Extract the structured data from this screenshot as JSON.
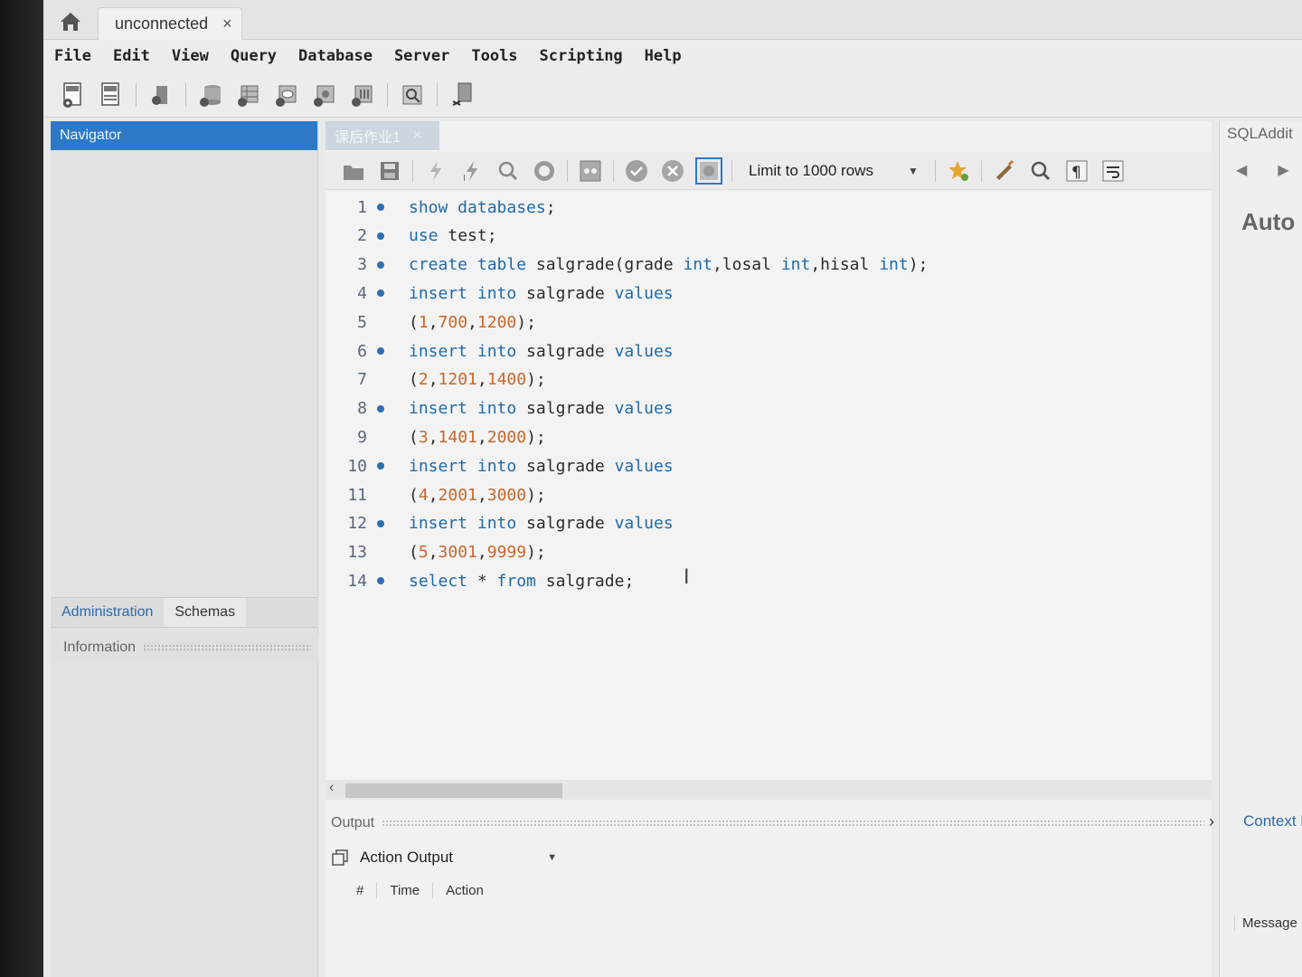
{
  "tabs": {
    "connection_label": "unconnected",
    "close_glyph": "×",
    "home_icon": "home-icon"
  },
  "menu": [
    "File",
    "Edit",
    "View",
    "Query",
    "Database",
    "Server",
    "Tools",
    "Scripting",
    "Help"
  ],
  "navigator": {
    "title": "Navigator",
    "tabs": [
      "Administration",
      "Schemas"
    ],
    "info_label": "Information"
  },
  "editor": {
    "tab_label": "课后作业1",
    "limit_label": "Limit to 1000 rows",
    "lines": [
      {
        "n": "1",
        "bp": true,
        "tokens": [
          {
            "t": "show databases",
            "c": "kw"
          },
          {
            "t": ";"
          }
        ]
      },
      {
        "n": "2",
        "bp": true,
        "tokens": [
          {
            "t": "use",
            "c": "kw"
          },
          {
            "t": " test;"
          }
        ]
      },
      {
        "n": "3",
        "bp": true,
        "tokens": [
          {
            "t": "create table",
            "c": "kw"
          },
          {
            "t": " salgrade(grade "
          },
          {
            "t": "int",
            "c": "kw"
          },
          {
            "t": ",losal "
          },
          {
            "t": "int",
            "c": "kw"
          },
          {
            "t": ",hisal "
          },
          {
            "t": "int",
            "c": "kw"
          },
          {
            "t": ");"
          }
        ]
      },
      {
        "n": "4",
        "bp": true,
        "tokens": [
          {
            "t": "insert into",
            "c": "kw"
          },
          {
            "t": " salgrade "
          },
          {
            "t": "values",
            "c": "kw"
          }
        ]
      },
      {
        "n": "5",
        "bp": false,
        "tokens": [
          {
            "t": "("
          },
          {
            "t": "1",
            "c": "num"
          },
          {
            "t": ","
          },
          {
            "t": "700",
            "c": "num"
          },
          {
            "t": ","
          },
          {
            "t": "1200",
            "c": "num"
          },
          {
            "t": ");"
          }
        ]
      },
      {
        "n": "6",
        "bp": true,
        "tokens": [
          {
            "t": "insert into",
            "c": "kw"
          },
          {
            "t": " salgrade "
          },
          {
            "t": "values",
            "c": "kw"
          }
        ]
      },
      {
        "n": "7",
        "bp": false,
        "tokens": [
          {
            "t": "("
          },
          {
            "t": "2",
            "c": "num"
          },
          {
            "t": ","
          },
          {
            "t": "1201",
            "c": "num"
          },
          {
            "t": ","
          },
          {
            "t": "1400",
            "c": "num"
          },
          {
            "t": ");"
          }
        ]
      },
      {
        "n": "8",
        "bp": true,
        "tokens": [
          {
            "t": "insert into",
            "c": "kw"
          },
          {
            "t": " salgrade "
          },
          {
            "t": "values",
            "c": "kw"
          }
        ]
      },
      {
        "n": "9",
        "bp": false,
        "tokens": [
          {
            "t": "("
          },
          {
            "t": "3",
            "c": "num"
          },
          {
            "t": ","
          },
          {
            "t": "1401",
            "c": "num"
          },
          {
            "t": ","
          },
          {
            "t": "2000",
            "c": "num"
          },
          {
            "t": ");"
          }
        ]
      },
      {
        "n": "10",
        "bp": true,
        "tokens": [
          {
            "t": "insert into",
            "c": "kw"
          },
          {
            "t": " salgrade "
          },
          {
            "t": "values",
            "c": "kw"
          }
        ]
      },
      {
        "n": "11",
        "bp": false,
        "tokens": [
          {
            "t": "("
          },
          {
            "t": "4",
            "c": "num"
          },
          {
            "t": ","
          },
          {
            "t": "2001",
            "c": "num"
          },
          {
            "t": ","
          },
          {
            "t": "3000",
            "c": "num"
          },
          {
            "t": ");"
          }
        ]
      },
      {
        "n": "12",
        "bp": true,
        "tokens": [
          {
            "t": "insert into",
            "c": "kw"
          },
          {
            "t": " salgrade "
          },
          {
            "t": "values",
            "c": "kw"
          }
        ]
      },
      {
        "n": "13",
        "bp": false,
        "tokens": [
          {
            "t": "("
          },
          {
            "t": "5",
            "c": "num"
          },
          {
            "t": ","
          },
          {
            "t": "3001",
            "c": "num"
          },
          {
            "t": ","
          },
          {
            "t": "9999",
            "c": "num"
          },
          {
            "t": ");"
          }
        ]
      },
      {
        "n": "14",
        "bp": true,
        "tokens": [
          {
            "t": "select",
            "c": "kw"
          },
          {
            "t": " * "
          },
          {
            "t": "from",
            "c": "kw"
          },
          {
            "t": " salgrade;"
          }
        ]
      }
    ]
  },
  "output": {
    "header": "Output",
    "selector_label": "Action Output",
    "columns": [
      "#",
      "Time",
      "Action"
    ],
    "message_col": "Message"
  },
  "right_panel": {
    "title": "SQLAddit",
    "auto_label": "Auto",
    "context_help": "Context Help",
    "back_arrow": "◀",
    "forward_arrow": "▶",
    "chevron": "›"
  },
  "colors": {
    "keyword": "#1f6aa8",
    "number": "#c8672a",
    "navigator_header": "#2d79c7",
    "breakpoint": "#2c6fb3"
  }
}
